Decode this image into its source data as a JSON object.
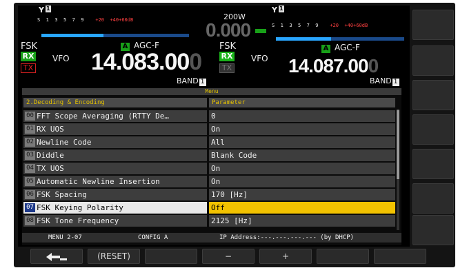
{
  "power": "200W",
  "center_freq_small": "0.000",
  "meter_scale": [
    "S",
    "1",
    "3",
    "5",
    "7",
    "9",
    "+20",
    "+40",
    "+60dB"
  ],
  "vfo_a": {
    "antenna": "1",
    "mode": "FSK",
    "rx": "RX",
    "tx": "TX",
    "vfo_label": "VFO",
    "vfo_badge": "A",
    "agc": "AGC-F",
    "freq_main": "14.083.00",
    "freq_last": "0",
    "band_label": "BAND",
    "band_num": "1"
  },
  "vfo_b": {
    "antenna": "1",
    "mode": "FSK",
    "rx": "RX",
    "tx": "TX",
    "vfo_label": "VFO",
    "vfo_badge": "A",
    "agc": "AGC-F",
    "freq_main": "14.087.00",
    "freq_last": "0",
    "band_label": "BAND",
    "band_num": "1"
  },
  "menu": {
    "title": "Menu",
    "header_left": "2.Decoding & Encoding",
    "header_right": "Parameter",
    "rows": [
      {
        "num": "00",
        "name": "FFT Scope Averaging (RTTY De…",
        "value": "0"
      },
      {
        "num": "01",
        "name": "RX UOS",
        "value": "On"
      },
      {
        "num": "02",
        "name": "Newline Code",
        "value": "All"
      },
      {
        "num": "03",
        "name": "Diddle",
        "value": "Blank Code"
      },
      {
        "num": "04",
        "name": "TX UOS",
        "value": "On"
      },
      {
        "num": "05",
        "name": "Automatic Newline Insertion",
        "value": "On"
      },
      {
        "num": "06",
        "name": "FSK Spacing",
        "value": "170 [Hz]"
      },
      {
        "num": "07",
        "name": "FSK Keying Polarity",
        "value": "Off"
      },
      {
        "num": "08",
        "name": "FSK Tone Frequency",
        "value": "2125 [Hz]"
      }
    ],
    "selected_index": 7,
    "status_menu": "MENU 2-07",
    "status_config": "CONFIG A",
    "status_ip": "IP Address:---.---.---.--- (by DHCP)"
  },
  "softkeys": {
    "back_icon": "return-arrow-icon",
    "reset": "(RESET)",
    "minus": "−",
    "plus": "+"
  },
  "colors": {
    "selected_value_bg": "#f2c200",
    "header_text": "#e6c200",
    "rx_green": "#18a018",
    "tx_red": "#e02020"
  }
}
